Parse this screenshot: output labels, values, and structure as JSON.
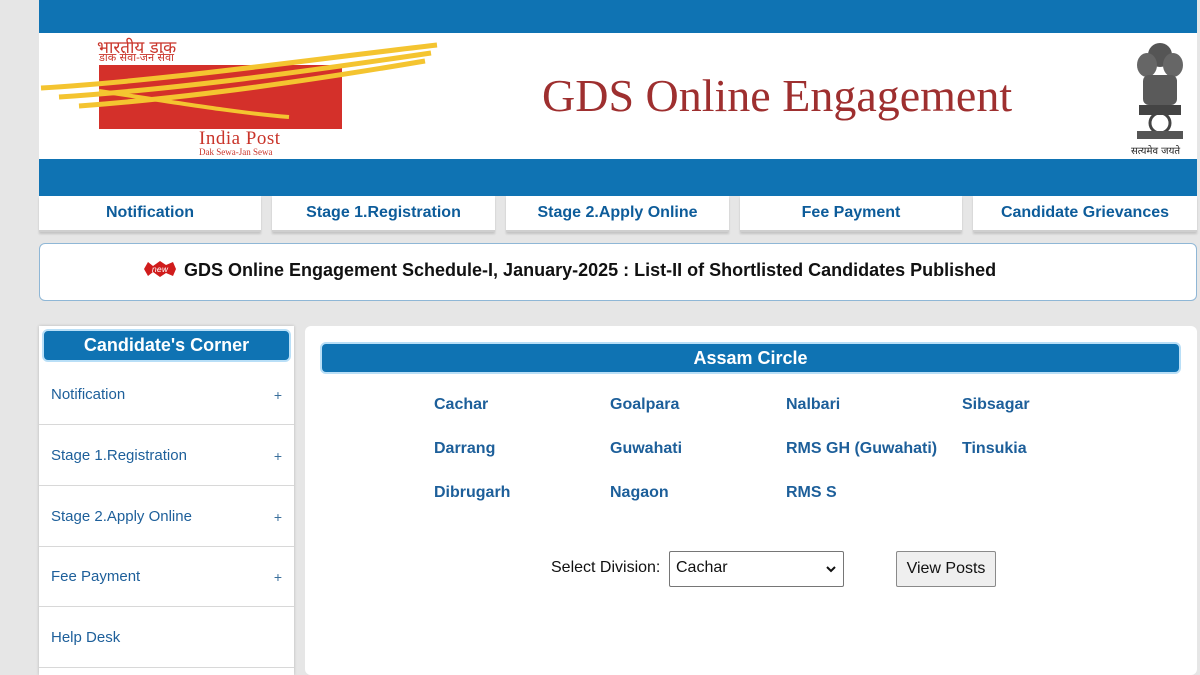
{
  "logo": {
    "hindi_top": "भारतीय डाक",
    "hindi_sub": "डाक सेवा-जन सेवा",
    "name": "India Post",
    "tagline": "Dak Sewa-Jan Sewa"
  },
  "header": {
    "title": "GDS Online Engagement",
    "emblem_motto": "सत्यमेव जयते"
  },
  "nav": [
    {
      "label": "Notification"
    },
    {
      "label": "Stage 1.Registration"
    },
    {
      "label": "Stage 2.Apply Online"
    },
    {
      "label": "Fee Payment"
    },
    {
      "label": "Candidate Grievances"
    }
  ],
  "announcement": {
    "badge": "new",
    "text": "GDS Online Engagement Schedule-I, January-2025 : List-II of Shortlisted Candidates Published"
  },
  "sidebar": {
    "title": "Candidate's Corner",
    "items": [
      {
        "label": "Notification",
        "expand": "+"
      },
      {
        "label": "Stage 1.Registration",
        "expand": "+"
      },
      {
        "label": "Stage 2.Apply Online",
        "expand": "+"
      },
      {
        "label": "Fee Payment",
        "expand": "+"
      },
      {
        "label": "Help Desk",
        "expand": ""
      }
    ]
  },
  "main": {
    "circle_title": "Assam Circle",
    "divisions": [
      "Cachar",
      "Goalpara",
      "Nalbari",
      "Sibsagar",
      "Darrang",
      "Guwahati",
      "RMS GH (Guwahati)",
      "Tinsukia",
      "Dibrugarh",
      "Nagaon",
      "RMS S"
    ],
    "select_label": "Select Division:",
    "select_value": "Cachar",
    "view_button": "View Posts"
  },
  "colors": {
    "primary_blue": "#0f73b3",
    "title_maroon": "#9e2f2f",
    "link_blue": "#1d5f9a",
    "logo_red": "#d4302a",
    "logo_yellow": "#f4c430"
  }
}
